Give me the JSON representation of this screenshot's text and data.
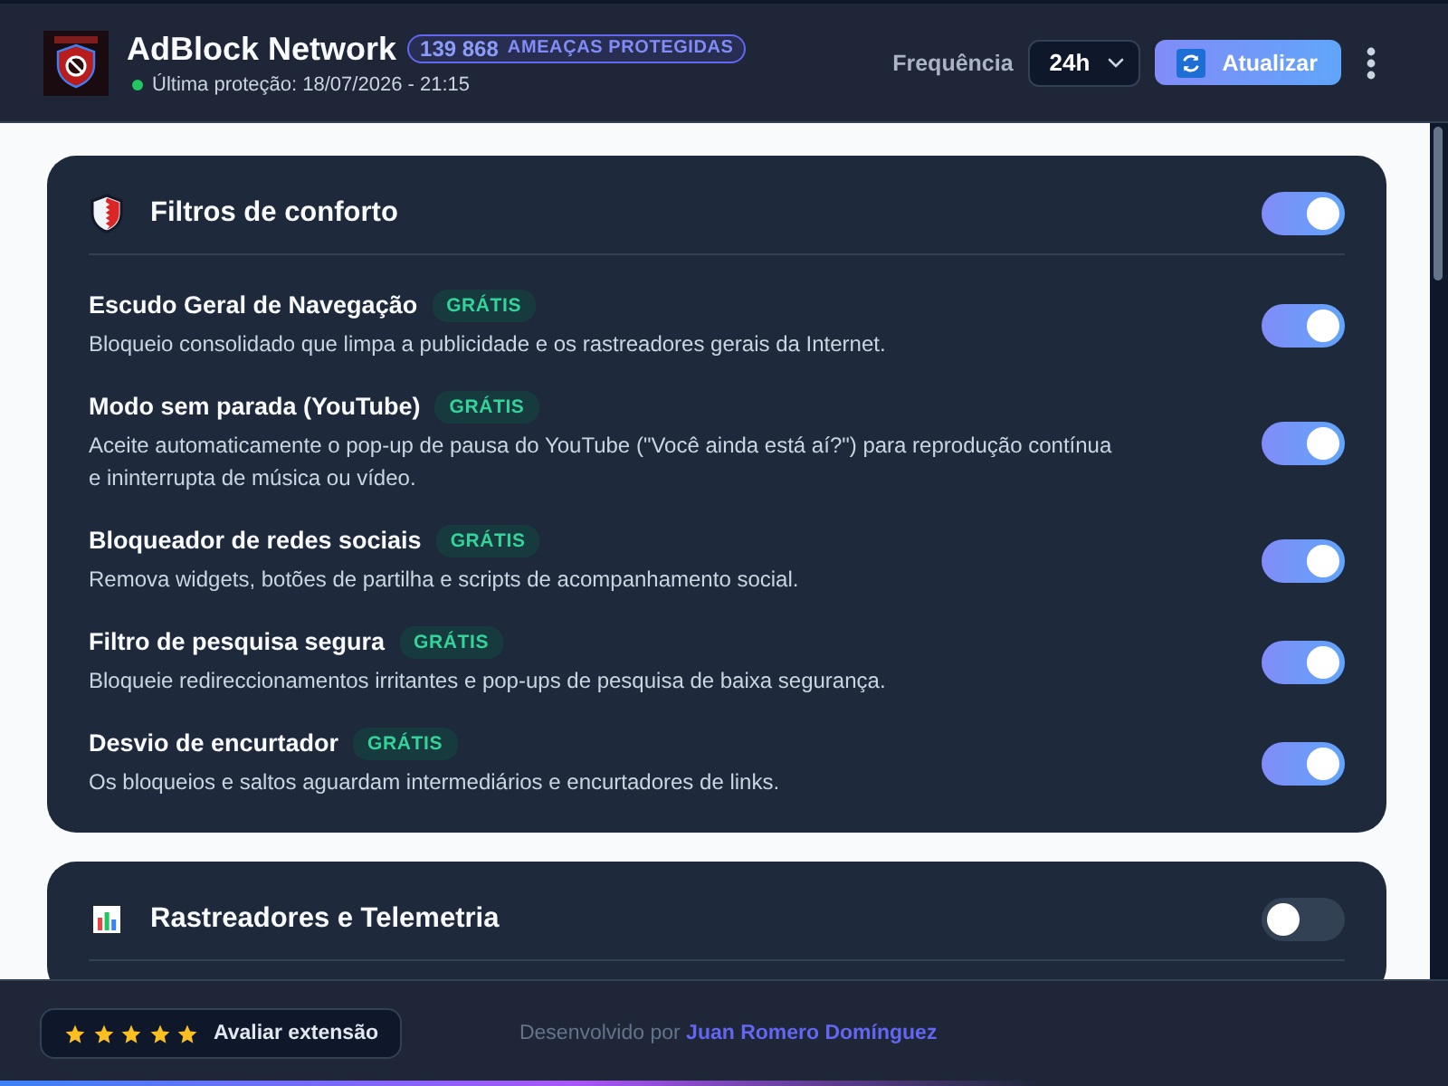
{
  "header": {
    "title": "AdBlock Network",
    "threat_count": "139 868",
    "threat_label": "AMEAÇAS PROTEGIDAS",
    "last_protection": "Última proteção: 18/07/2026 - 21:15",
    "frequency_label": "Frequência",
    "frequency": "24h",
    "update_button": "Atualizar"
  },
  "sections": [
    {
      "title": "Filtros de conforto",
      "on": true,
      "filters": [
        {
          "name": "Escudo Geral de Navegação",
          "badge": "GRÁTIS",
          "description": "Bloqueio consolidado que limpa a publicidade e os rastreadores gerais da Internet.",
          "on": true
        },
        {
          "name": "Modo sem parada (YouTube)",
          "badge": "GRÁTIS",
          "description": "Aceite automaticamente o pop-up de pausa do YouTube (\"Você ainda está aí?\") para reprodução contínua e ininterrupta de música ou vídeo.",
          "on": true
        },
        {
          "name": "Bloqueador de redes sociais",
          "badge": "GRÁTIS",
          "description": "Remova widgets, botões de partilha e scripts de acompanhamento social.",
          "on": true
        },
        {
          "name": "Filtro de pesquisa segura",
          "badge": "GRÁTIS",
          "description": "Bloqueie redireccionamentos irritantes e pop-ups de pesquisa de baixa segurança.",
          "on": true
        },
        {
          "name": "Desvio de encurtador",
          "badge": "GRÁTIS",
          "description": "Os bloqueios e saltos aguardam intermediários e encurtadores de links.",
          "on": true
        }
      ]
    },
    {
      "title": "Rastreadores e Telemetria",
      "on": false
    }
  ],
  "footer": {
    "stars": 5,
    "rate_button": "Avaliar extensão",
    "credit": "Desenvolvido por",
    "author": "Juan Romero Domínguez"
  }
}
